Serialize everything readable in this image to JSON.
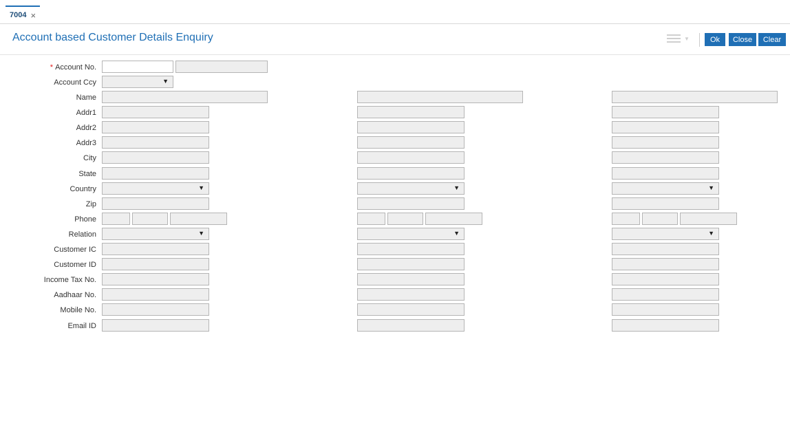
{
  "tab": {
    "label": "7004",
    "close_glyph": "×"
  },
  "header": {
    "title": "Account based Customer Details Enquiry",
    "menu_icon": "hamburger-menu-icon"
  },
  "toolbar": {
    "ok_label": "Ok",
    "close_label": "Close",
    "clear_label": "Clear",
    "accent_color": "#1f6fb5"
  },
  "form": {
    "required_marker": "*",
    "account_no_label": "Account No.",
    "account_ccy_label": "Account Ccy",
    "rows": [
      {
        "label": "Name"
      },
      {
        "label": "Addr1"
      },
      {
        "label": "Addr2"
      },
      {
        "label": "Addr3"
      },
      {
        "label": "City"
      },
      {
        "label": "State"
      },
      {
        "label": "Country"
      },
      {
        "label": "Zip"
      },
      {
        "label": "Phone"
      },
      {
        "label": "Relation"
      },
      {
        "label": "Customer IC"
      },
      {
        "label": "Customer ID"
      },
      {
        "label": "Income Tax No."
      },
      {
        "label": "Aadhaar No."
      },
      {
        "label": "Mobile No."
      },
      {
        "label": "Email ID"
      }
    ]
  }
}
